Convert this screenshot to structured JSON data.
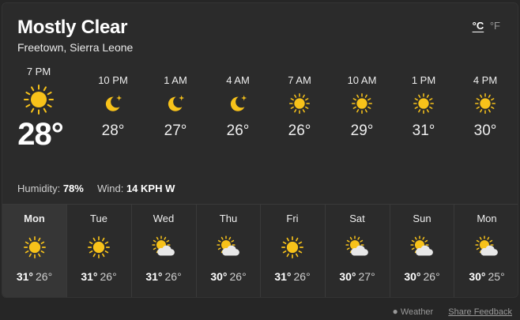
{
  "condition": "Mostly Clear",
  "location": "Freetown, Sierra Leone",
  "units": {
    "c": "°C",
    "f": "°F"
  },
  "now": {
    "time": "7 PM",
    "temp": "28°",
    "icon": "sun-icon"
  },
  "hourly": [
    {
      "time": "10 PM",
      "temp": "28°",
      "icon": "moon-star-icon"
    },
    {
      "time": "1 AM",
      "temp": "27°",
      "icon": "moon-star-icon"
    },
    {
      "time": "4 AM",
      "temp": "26°",
      "icon": "moon-star-icon"
    },
    {
      "time": "7 AM",
      "temp": "26°",
      "icon": "sun-icon"
    },
    {
      "time": "10 AM",
      "temp": "29°",
      "icon": "sun-icon"
    },
    {
      "time": "1 PM",
      "temp": "31°",
      "icon": "sun-icon"
    },
    {
      "time": "4 PM",
      "temp": "30°",
      "icon": "sun-icon"
    }
  ],
  "humidity": {
    "label": "Humidity:",
    "value": "78%"
  },
  "wind": {
    "label": "Wind:",
    "value": "14 KPH W"
  },
  "daily": [
    {
      "day": "Mon",
      "high": "31°",
      "low": "26°",
      "icon": "sun-icon"
    },
    {
      "day": "Tue",
      "high": "31°",
      "low": "26°",
      "icon": "sun-icon"
    },
    {
      "day": "Wed",
      "high": "31°",
      "low": "26°",
      "icon": "sun-cloud-icon"
    },
    {
      "day": "Thu",
      "high": "30°",
      "low": "26°",
      "icon": "sun-cloud-icon"
    },
    {
      "day": "Fri",
      "high": "31°",
      "low": "26°",
      "icon": "sun-icon"
    },
    {
      "day": "Sat",
      "high": "30°",
      "low": "27°",
      "icon": "sun-cloud-icon"
    },
    {
      "day": "Sun",
      "high": "30°",
      "low": "26°",
      "icon": "sun-cloud-icon"
    },
    {
      "day": "Mon",
      "high": "30°",
      "low": "25°",
      "icon": "sun-cloud-icon"
    }
  ],
  "footer": {
    "brand": "Weather",
    "feedback": "Share Feedback"
  },
  "colors": {
    "sun": "#F7C21A",
    "cloud": "#E8E8E8",
    "card": "#2B2B2B"
  }
}
